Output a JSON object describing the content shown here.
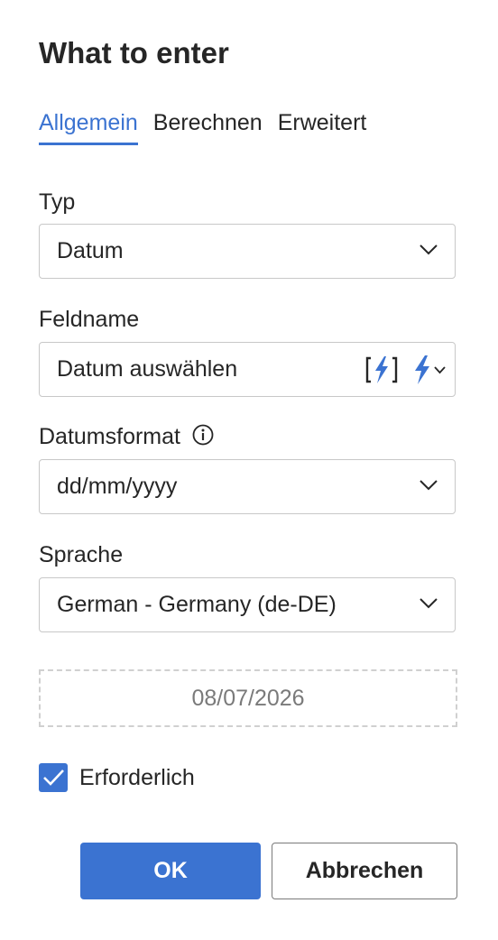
{
  "dialog": {
    "title": "What to enter"
  },
  "tabs": [
    {
      "label": "Allgemein",
      "active": true
    },
    {
      "label": "Berechnen",
      "active": false
    },
    {
      "label": "Erweitert",
      "active": false
    }
  ],
  "fields": {
    "typ": {
      "label": "Typ",
      "value": "Datum"
    },
    "feldname": {
      "label": "Feldname",
      "value": "Datum auswählen"
    },
    "datumsformat": {
      "label": "Datumsformat",
      "value": "dd/mm/yyyy"
    },
    "sprache": {
      "label": "Sprache",
      "value": "German - Germany (de-DE)"
    }
  },
  "preview": {
    "value": "08/07/2026"
  },
  "required": {
    "label": "Erforderlich",
    "checked": true
  },
  "buttons": {
    "ok": "OK",
    "cancel": "Abbrechen"
  },
  "colors": {
    "accent": "#3b73d1",
    "text": "#262626",
    "border": "#c8c8c8",
    "muted": "#7a7a7a"
  },
  "icons": {
    "dropdown": "chevron-down-icon",
    "info": "info-icon",
    "formula": "bracket-lightning-icon",
    "merge_field": "lightning-icon"
  }
}
